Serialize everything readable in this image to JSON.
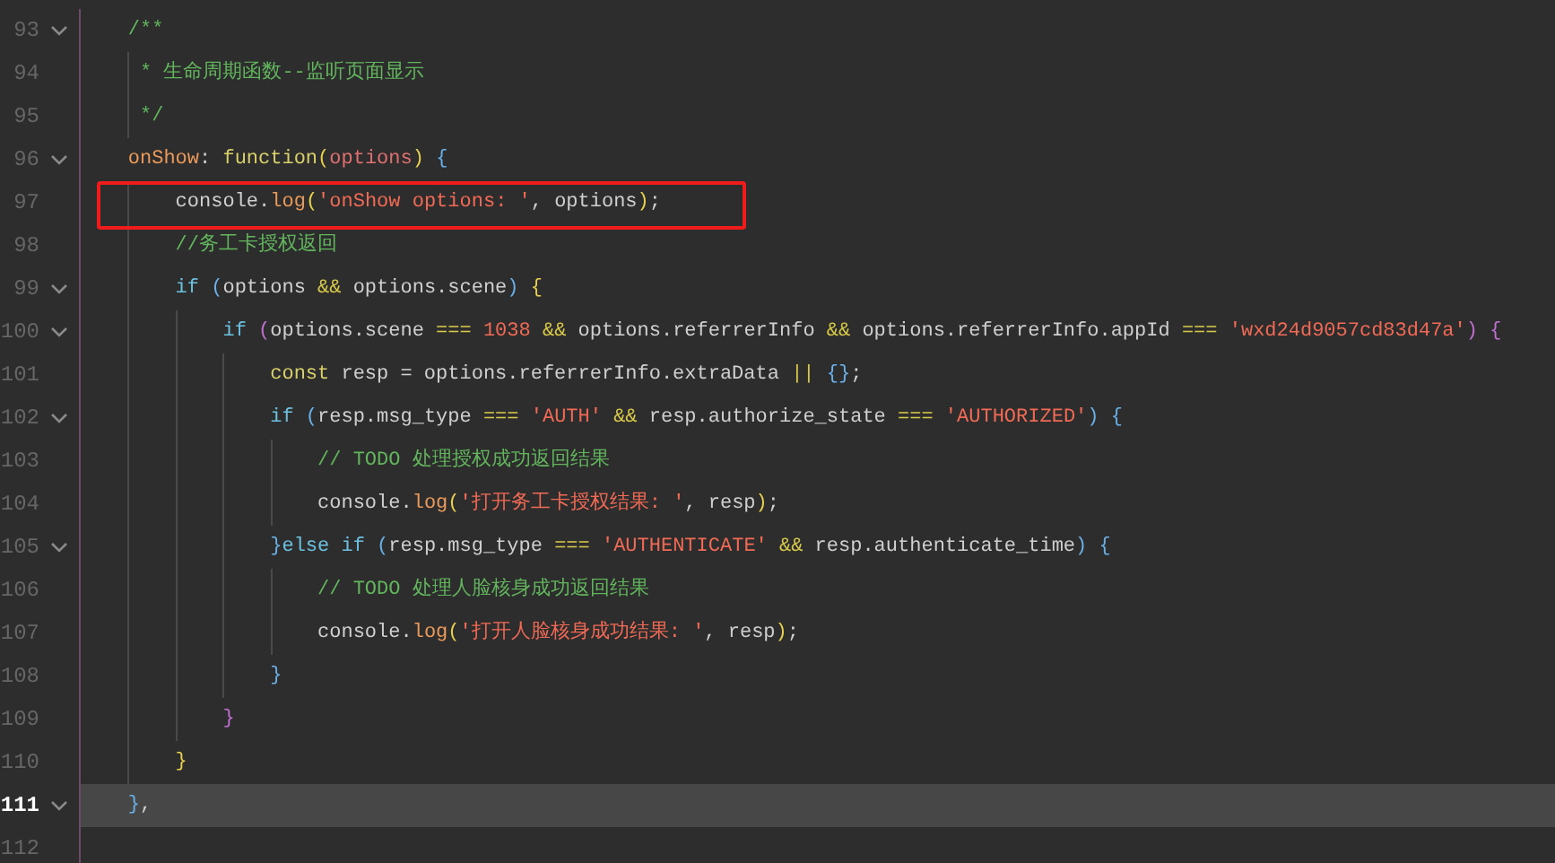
{
  "editor": {
    "lines": [
      {
        "number": "93",
        "foldable": true,
        "current": false,
        "annotated": false,
        "tokens": [
          {
            "kind": "comment",
            "text": "    /**"
          }
        ]
      },
      {
        "number": "94",
        "foldable": false,
        "current": false,
        "annotated": false,
        "tokens": [
          {
            "kind": "comment",
            "text": "     * 生命周期函数--监听页面显示"
          }
        ]
      },
      {
        "number": "95",
        "foldable": false,
        "current": false,
        "annotated": false,
        "tokens": [
          {
            "kind": "comment",
            "text": "     */"
          }
        ]
      },
      {
        "number": "96",
        "foldable": true,
        "current": false,
        "annotated": false,
        "tokens": [
          {
            "kind": "method",
            "text": "    onShow"
          },
          {
            "kind": "plain",
            "text": ": "
          },
          {
            "kind": "keyword",
            "text": "function"
          },
          {
            "kind": "brace3",
            "text": "("
          },
          {
            "kind": "param",
            "text": "options"
          },
          {
            "kind": "brace3",
            "text": ")"
          },
          {
            "kind": "brace",
            "text": " {"
          }
        ]
      },
      {
        "number": "97",
        "foldable": false,
        "current": false,
        "annotated": true,
        "tokens": [
          {
            "kind": "plain",
            "text": "        console."
          },
          {
            "kind": "method",
            "text": "log"
          },
          {
            "kind": "brace3",
            "text": "("
          },
          {
            "kind": "string",
            "text": "'onShow options: '"
          },
          {
            "kind": "plain",
            "text": ", options"
          },
          {
            "kind": "brace3",
            "text": ")"
          },
          {
            "kind": "plain",
            "text": ";"
          }
        ]
      },
      {
        "number": "98",
        "foldable": false,
        "current": false,
        "annotated": false,
        "tokens": [
          {
            "kind": "comment",
            "text": "        //务工卡授权返回"
          }
        ]
      },
      {
        "number": "99",
        "foldable": true,
        "current": false,
        "annotated": false,
        "tokens": [
          {
            "kind": "control",
            "text": "        if"
          },
          {
            "kind": "brace",
            "text": " ("
          },
          {
            "kind": "plain",
            "text": "options "
          },
          {
            "kind": "operator",
            "text": "&&"
          },
          {
            "kind": "plain",
            "text": " options.scene"
          },
          {
            "kind": "brace",
            "text": ")"
          },
          {
            "kind": "brace3",
            "text": " {"
          }
        ]
      },
      {
        "number": "100",
        "foldable": true,
        "current": false,
        "annotated": false,
        "tokens": [
          {
            "kind": "control",
            "text": "            if"
          },
          {
            "kind": "brace2",
            "text": " ("
          },
          {
            "kind": "plain",
            "text": "options.scene "
          },
          {
            "kind": "operator",
            "text": "==="
          },
          {
            "kind": "number",
            "text": " 1038 "
          },
          {
            "kind": "operator",
            "text": "&&"
          },
          {
            "kind": "plain",
            "text": " options.referrerInfo "
          },
          {
            "kind": "operator",
            "text": "&&"
          },
          {
            "kind": "plain",
            "text": " options.referrerInfo.appId "
          },
          {
            "kind": "operator",
            "text": "==="
          },
          {
            "kind": "string",
            "text": " 'wxd24d9057cd83d47a'"
          },
          {
            "kind": "brace2",
            "text": ") {"
          }
        ]
      },
      {
        "number": "101",
        "foldable": false,
        "current": false,
        "annotated": false,
        "tokens": [
          {
            "kind": "keyword",
            "text": "                const"
          },
          {
            "kind": "plain",
            "text": " resp = options.referrerInfo.extraData "
          },
          {
            "kind": "operator",
            "text": "||"
          },
          {
            "kind": "brace",
            "text": " {}"
          },
          {
            "kind": "plain",
            "text": ";"
          }
        ]
      },
      {
        "number": "102",
        "foldable": true,
        "current": false,
        "annotated": false,
        "tokens": [
          {
            "kind": "control",
            "text": "                if"
          },
          {
            "kind": "brace",
            "text": " ("
          },
          {
            "kind": "plain",
            "text": "resp.msg_type "
          },
          {
            "kind": "operator",
            "text": "==="
          },
          {
            "kind": "string",
            "text": " 'AUTH' "
          },
          {
            "kind": "operator",
            "text": "&&"
          },
          {
            "kind": "plain",
            "text": " resp.authorize_state "
          },
          {
            "kind": "operator",
            "text": "==="
          },
          {
            "kind": "string",
            "text": " 'AUTHORIZED'"
          },
          {
            "kind": "brace",
            "text": ") {"
          }
        ]
      },
      {
        "number": "103",
        "foldable": false,
        "current": false,
        "annotated": false,
        "tokens": [
          {
            "kind": "comment",
            "text": "                    // TODO 处理授权成功返回结果"
          }
        ]
      },
      {
        "number": "104",
        "foldable": false,
        "current": false,
        "annotated": false,
        "tokens": [
          {
            "kind": "plain",
            "text": "                    console."
          },
          {
            "kind": "method",
            "text": "log"
          },
          {
            "kind": "brace3",
            "text": "("
          },
          {
            "kind": "string",
            "text": "'打开务工卡授权结果: '"
          },
          {
            "kind": "plain",
            "text": ", resp"
          },
          {
            "kind": "brace3",
            "text": ")"
          },
          {
            "kind": "plain",
            "text": ";"
          }
        ]
      },
      {
        "number": "105",
        "foldable": true,
        "current": false,
        "annotated": false,
        "tokens": [
          {
            "kind": "brace",
            "text": "                }"
          },
          {
            "kind": "control",
            "text": "else if"
          },
          {
            "kind": "brace",
            "text": " ("
          },
          {
            "kind": "plain",
            "text": "resp.msg_type "
          },
          {
            "kind": "operator",
            "text": "==="
          },
          {
            "kind": "string",
            "text": " 'AUTHENTICATE' "
          },
          {
            "kind": "operator",
            "text": "&&"
          },
          {
            "kind": "plain",
            "text": " resp.authenticate_time"
          },
          {
            "kind": "brace",
            "text": ") {"
          }
        ]
      },
      {
        "number": "106",
        "foldable": false,
        "current": false,
        "annotated": false,
        "tokens": [
          {
            "kind": "comment",
            "text": "                    // TODO 处理人脸核身成功返回结果"
          }
        ]
      },
      {
        "number": "107",
        "foldable": false,
        "current": false,
        "annotated": false,
        "tokens": [
          {
            "kind": "plain",
            "text": "                    console."
          },
          {
            "kind": "method",
            "text": "log"
          },
          {
            "kind": "brace3",
            "text": "("
          },
          {
            "kind": "string",
            "text": "'打开人脸核身成功结果: '"
          },
          {
            "kind": "plain",
            "text": ", resp"
          },
          {
            "kind": "brace3",
            "text": ")"
          },
          {
            "kind": "plain",
            "text": ";"
          }
        ]
      },
      {
        "number": "108",
        "foldable": false,
        "current": false,
        "annotated": false,
        "tokens": [
          {
            "kind": "brace",
            "text": "                }"
          }
        ]
      },
      {
        "number": "109",
        "foldable": false,
        "current": false,
        "annotated": false,
        "tokens": [
          {
            "kind": "brace2",
            "text": "            }"
          }
        ]
      },
      {
        "number": "110",
        "foldable": false,
        "current": false,
        "annotated": false,
        "tokens": [
          {
            "kind": "brace3",
            "text": "        }"
          }
        ]
      },
      {
        "number": "111",
        "foldable": true,
        "current": true,
        "annotated": false,
        "tokens": [
          {
            "kind": "brace",
            "text": "    }"
          },
          {
            "kind": "plain",
            "text": ","
          }
        ]
      },
      {
        "number": "112",
        "foldable": false,
        "current": false,
        "annotated": false
      }
    ]
  }
}
